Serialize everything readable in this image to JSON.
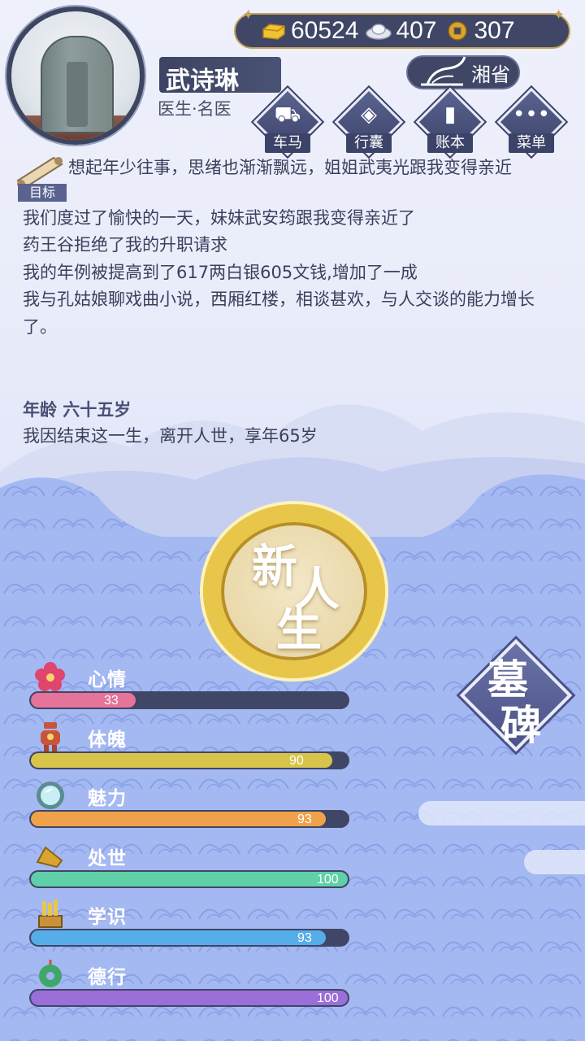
{
  "currency": {
    "gold": "60524",
    "silver": "407",
    "copper": "307"
  },
  "player": {
    "name": "武诗琳",
    "title": "医生·名医"
  },
  "region": {
    "label": "湘省"
  },
  "menu": [
    {
      "label": "车马",
      "icon": "carriage-icon"
    },
    {
      "label": "行囊",
      "icon": "bag-icon"
    },
    {
      "label": "账本",
      "icon": "ledger-icon"
    },
    {
      "label": "菜单",
      "icon": "more-icon"
    }
  ],
  "goal": {
    "label": "目标"
  },
  "log": [
    "想起年少往事，思绪也渐渐飘远，姐姐武夷光跟我变得亲近",
    "我们度过了愉快的一天，妹妹武安筠跟我变得亲近了",
    "药王谷拒绝了我的升职请求",
    "我的年例被提高到了617两白银605文钱,增加了一成",
    "我与孔姑娘聊戏曲小说，西厢红楼，相谈甚欢，与人交谈的能力增长了。"
  ],
  "age": {
    "title": "年龄 六十五岁",
    "text": "我因结束这一生，离开人世，享年65岁"
  },
  "new_life": {
    "c1": "新",
    "c2": "人",
    "c3": "生"
  },
  "tomb": {
    "c1": "墓",
    "c2": "碑"
  },
  "stats": [
    {
      "label": "心情",
      "value": "33",
      "fraction": 0.33,
      "color": "#e5739a",
      "icon": "flower-icon"
    },
    {
      "label": "体魄",
      "value": "90",
      "fraction": 0.95,
      "color": "#d8c44a",
      "icon": "body-icon"
    },
    {
      "label": "魅力",
      "value": "93",
      "fraction": 0.93,
      "color": "#f0a24a",
      "icon": "mirror-icon"
    },
    {
      "label": "处世",
      "value": "100",
      "fraction": 1.0,
      "color": "#5fd0a8",
      "icon": "hand-icon"
    },
    {
      "label": "学识",
      "value": "93",
      "fraction": 0.93,
      "color": "#56aee8",
      "icon": "books-icon"
    },
    {
      "label": "德行",
      "value": "100",
      "fraction": 1.0,
      "color": "#9b6ed8",
      "icon": "jade-icon"
    }
  ]
}
